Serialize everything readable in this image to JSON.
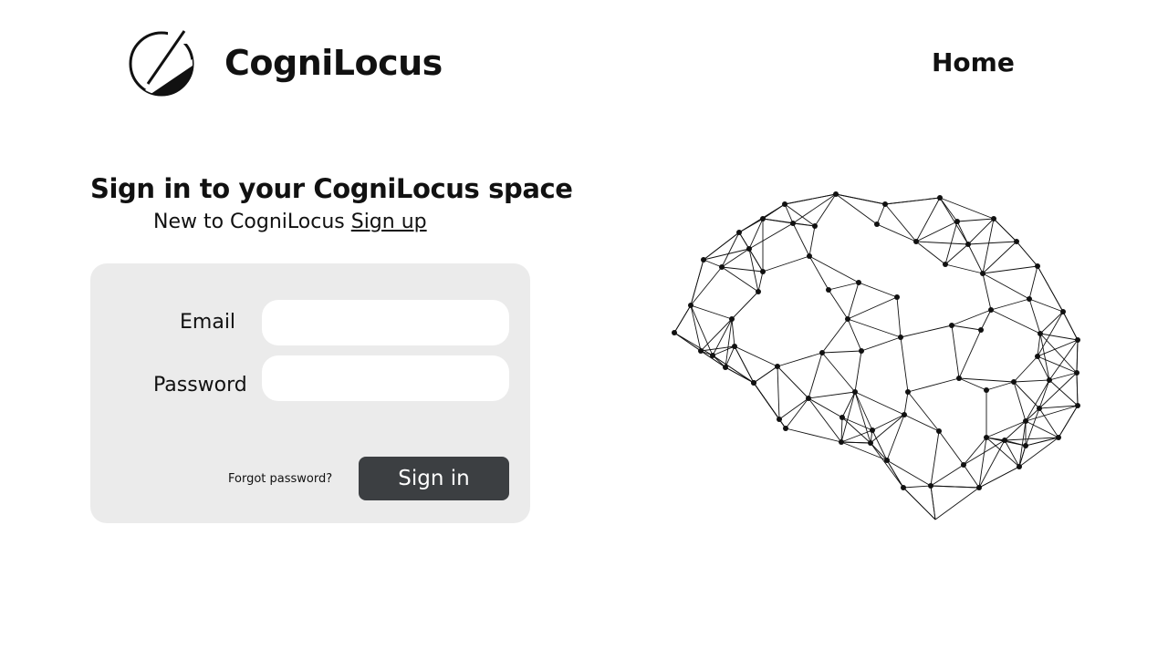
{
  "header": {
    "brand_name": "CogniLocus",
    "logo_icon": "half-circle-logo-icon",
    "nav": {
      "home_label": "Home"
    }
  },
  "signin": {
    "title": "Sign in to your CogniLocus space",
    "subtitle_prefix": "New to CogniLocus",
    "signup_label": "Sign up",
    "form": {
      "email_label": "Email",
      "email_value": "",
      "password_label": "Password",
      "password_value": "",
      "forgot_label": "Forgot password?",
      "submit_label": "Sign in"
    }
  },
  "illustration": {
    "icon": "brain-network-icon"
  },
  "colors": {
    "card_background": "#ebebeb",
    "button_background": "#3c3f42",
    "button_text": "#ffffff",
    "text": "#111111"
  }
}
